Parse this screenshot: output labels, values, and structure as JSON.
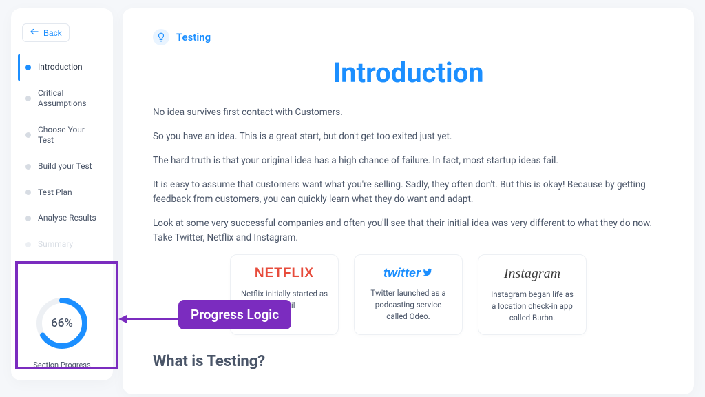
{
  "sidebar": {
    "back_label": "Back",
    "items": [
      {
        "label": "Introduction",
        "state": "active"
      },
      {
        "label": "Critical Assumptions",
        "state": ""
      },
      {
        "label": "Choose Your Test",
        "state": ""
      },
      {
        "label": "Build your Test",
        "state": ""
      },
      {
        "label": "Test Plan",
        "state": ""
      },
      {
        "label": "Analyse Results",
        "state": ""
      },
      {
        "label": "Summary",
        "state": "faded"
      }
    ],
    "progress": {
      "pct_text": "66%",
      "pct_value": 66,
      "label": "Section Progress"
    }
  },
  "breadcrumb": {
    "icon_glyph": "💡",
    "label": "Testing"
  },
  "content": {
    "title": "Introduction",
    "paragraphs": [
      "No idea survives first contact with Customers.",
      "So you have an idea. This is a great start, but don't get too exited just yet.",
      "The hard truth is that your original idea has a high chance of failure. In fact, most startup ideas fail.",
      "It is easy to assume that customers want what you're selling. Sadly, they often don't. But this is okay! Because by getting feedback from customers, you can quickly learn what they do want and adapt.",
      "Look at some very successful companies and often you'll see that their initial idea was very different to what they do now. Take Twitter, Netflix and Instagram."
    ],
    "cards": [
      {
        "brand": "NETFLIX",
        "text": "Netflix initially started as a mail"
      },
      {
        "brand": "twitter",
        "text": "Twitter launched as a podcasting service called Odeo."
      },
      {
        "brand": "Instagram",
        "text": "Instagram began life as a location check-in app called Burbn."
      }
    ],
    "subheading": "What is Testing?"
  },
  "annotation": {
    "label": "Progress Logic"
  }
}
